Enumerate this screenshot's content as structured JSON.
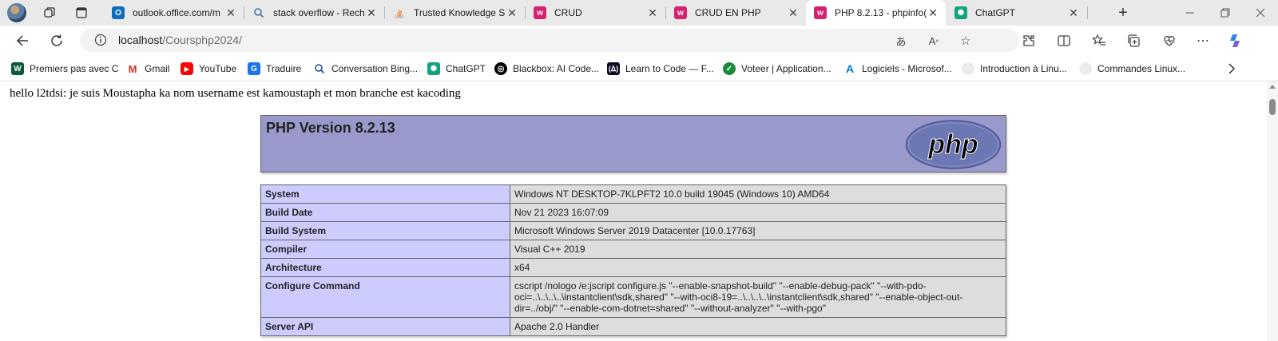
{
  "tabs": [
    {
      "label": "outlook.office.com/m",
      "favicon": "outlook-icon"
    },
    {
      "label": "stack overflow - Rech",
      "favicon": "search-icon"
    },
    {
      "label": "Trusted Knowledge Sh",
      "favicon": "stackoverflow-icon"
    },
    {
      "label": "CRUD",
      "favicon": "wamp-icon"
    },
    {
      "label": "CRUD EN PHP",
      "favicon": "wamp-icon"
    },
    {
      "label": "PHP 8.2.13 - phpinfo(",
      "favicon": "wamp-icon",
      "active": true
    },
    {
      "label": "ChatGPT",
      "favicon": "chatgpt-icon"
    }
  ],
  "address_bar": {
    "host": "localhost",
    "path": "/Coursphp2024/"
  },
  "bookmarks": [
    {
      "label": "Premiers pas avec C",
      "icon": "w-icon"
    },
    {
      "label": "Gmail",
      "icon": "gmail-icon"
    },
    {
      "label": "YouTube",
      "icon": "youtube-icon"
    },
    {
      "label": "Traduire",
      "icon": "translate-icon"
    },
    {
      "label": "Conversation Bing...",
      "icon": "bing-search-icon"
    },
    {
      "label": "ChatGPT",
      "icon": "chatgpt-icon"
    },
    {
      "label": "Blackbox: AI Code...",
      "icon": "blackbox-icon"
    },
    {
      "label": "Learn to Code — F...",
      "icon": "freecodecamp-icon"
    },
    {
      "label": "Voteer | Application...",
      "icon": "voteer-icon"
    },
    {
      "label": "Logiciels - Microsof...",
      "icon": "azure-icon"
    },
    {
      "label": "Introduction à Linu...",
      "icon": "globe-icon"
    },
    {
      "label": "Commandes Linux...",
      "icon": "globe-icon"
    }
  ],
  "page": {
    "hello_text": "hello l2tdsi: je suis Moustapha ka nom username est kamoustaph et mon branche est kacoding",
    "php_title": "PHP Version 8.2.13",
    "php_logo_text": "php",
    "info_rows": [
      {
        "key": "System",
        "value": "Windows NT DESKTOP-7KLPFT2 10.0 build 19045 (Windows 10) AMD64"
      },
      {
        "key": "Build Date",
        "value": "Nov 21 2023 16:07:09"
      },
      {
        "key": "Build System",
        "value": "Microsoft Windows Server 2019 Datacenter [10.0.17763]"
      },
      {
        "key": "Compiler",
        "value": "Visual C++ 2019"
      },
      {
        "key": "Architecture",
        "value": "x64"
      },
      {
        "key": "Configure Command",
        "value": "cscript /nologo /e:jscript configure.js \"--enable-snapshot-build\" \"--enable-debug-pack\" \"--with-pdo-oci=..\\..\\..\\..\\instantclient\\sdk,shared\" \"--with-oci8-19=..\\..\\..\\..\\instantclient\\sdk,shared\" \"--enable-object-out-dir=../obj/\" \"--enable-com-dotnet=shared\" \"--without-analyzer\" \"--with-pgo\""
      },
      {
        "key": "Server API",
        "value": "Apache 2.0 Handler"
      }
    ]
  },
  "colors": {
    "php_header_bg": "#9999cc",
    "key_cell_bg": "#ccccff",
    "value_cell_bg": "#dddddd",
    "wamp_brand": "#d6216e"
  }
}
